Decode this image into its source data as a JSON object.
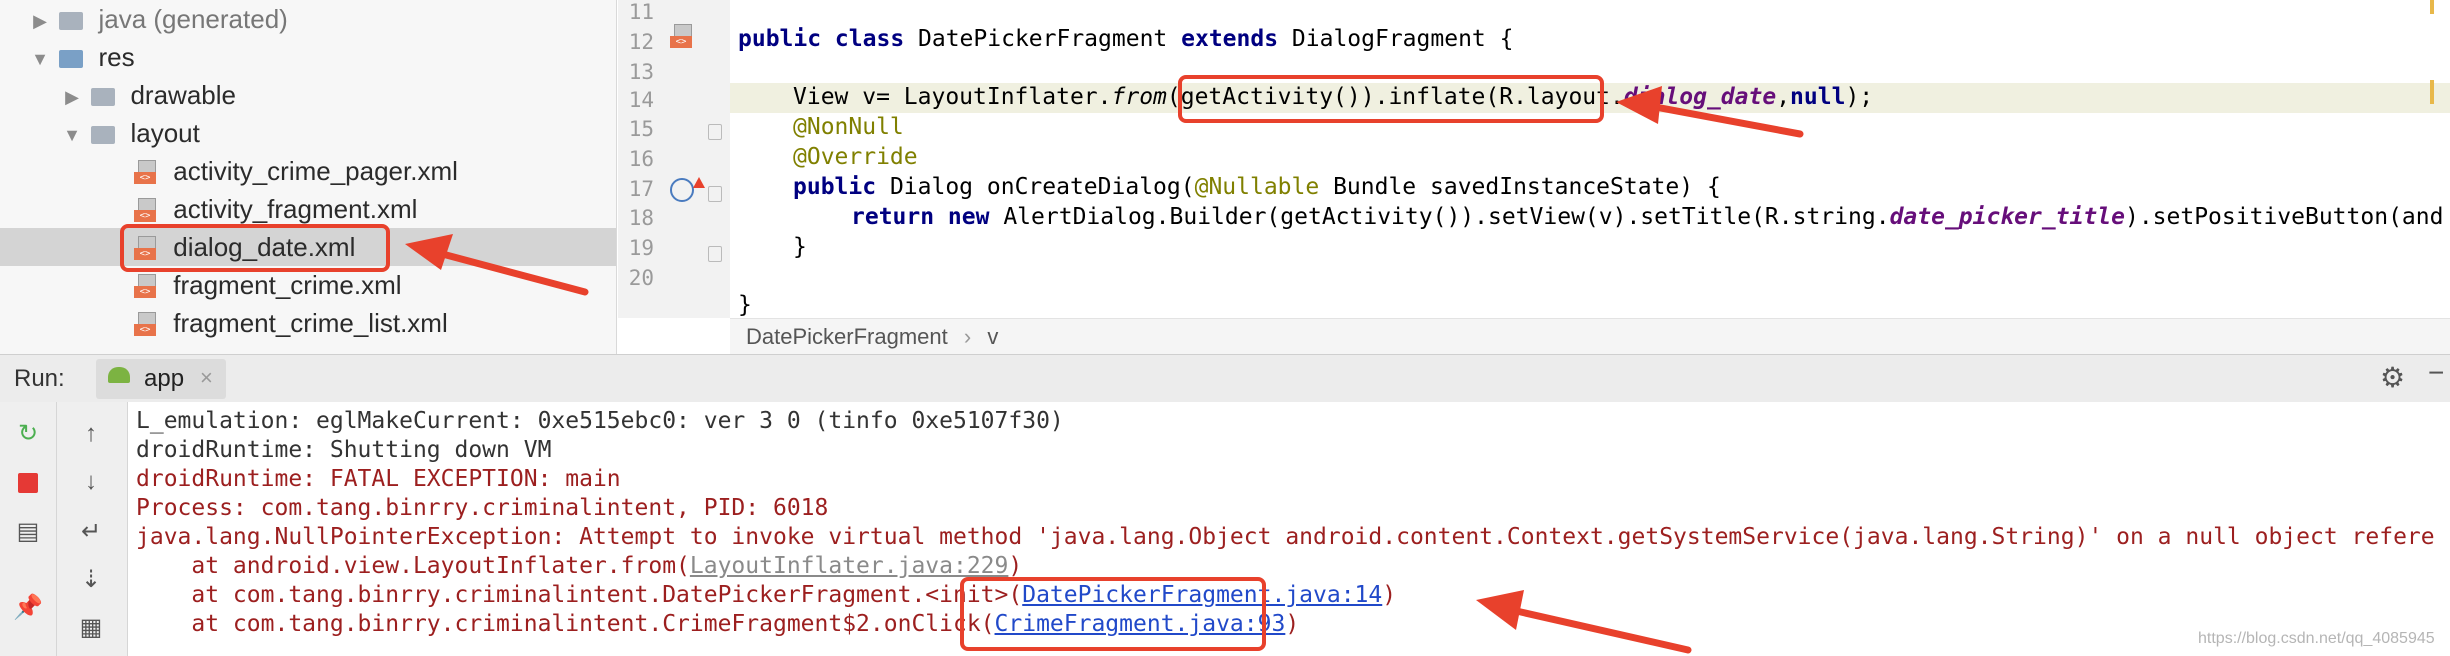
{
  "tree": [
    {
      "arrow": "▶",
      "icon": "folder-icon",
      "label": "java (generated)",
      "muted": true
    },
    {
      "arrow": "▼",
      "icon": "res-folder-icon",
      "label": "res"
    },
    {
      "arrow": "▶",
      "icon": "folder-icon",
      "label": "drawable"
    },
    {
      "arrow": "▼",
      "icon": "folder-icon",
      "label": "layout"
    },
    {
      "icon": "xml-file-icon",
      "label": "activity_crime_pager.xml"
    },
    {
      "icon": "xml-file-icon",
      "label": "activity_fragment.xml"
    },
    {
      "icon": "xml-file-icon",
      "label": "dialog_date.xml",
      "selected": true
    },
    {
      "icon": "xml-file-icon",
      "label": "fragment_crime.xml"
    },
    {
      "icon": "xml-file-icon",
      "label": "fragment_crime_list.xml"
    }
  ],
  "editor": {
    "line_numbers": [
      "11",
      "12",
      "13",
      "14",
      "15",
      "16",
      "17",
      "18",
      "19",
      "20"
    ],
    "line12": {
      "kw1": "public class",
      "name": " DatePickerFragment ",
      "kw2": "extends",
      "rest": " DialogFragment {"
    },
    "line14": {
      "pre": "View v= LayoutInflater.",
      "from": "from",
      "mid": "(getActivity()).inflate(R.layout.",
      "field": "dialog_date",
      "sep": ",",
      "null": "null",
      "end": ");"
    },
    "line15": "@NonNull",
    "line16": "@Override",
    "line17": {
      "kw": "public",
      "a": " Dialog onCreateDialog(",
      "ann": "@Nullable",
      "b": " Bundle savedInstanceState) {"
    },
    "line18": {
      "kw1": "return new",
      "a": " AlertDialog.Builder(getActivity()).setView(v).setTitle(R.string.",
      "field": "date_picker_title",
      "b": ").setPositiveButton(and"
    },
    "line19": "}",
    "line21": "}"
  },
  "breadcrumbs": [
    "DatePickerFragment",
    "v"
  ],
  "breadcrumb_sep": "›",
  "run": {
    "label": "Run:",
    "tab": "app",
    "close": "×"
  },
  "console": [
    {
      "text": "L_emulation: eglMakeCurrent: 0xe515ebc0: ver 3 0 (tinfo 0xe5107f30)",
      "style": "dark"
    },
    {
      "text": "droidRuntime: Shutting down VM",
      "style": "dark"
    },
    {
      "text": "droidRuntime: FATAL EXCEPTION: main"
    },
    {
      "text": "Process: com.tang.binrry.criminalintent, PID: 6018"
    },
    {
      "text": "java.lang.NullPointerException: Attempt to invoke virtual method 'java.lang.Object android.content.Context.getSystemService(java.lang.String)' on a null object refere"
    }
  ],
  "stack": [
    {
      "pre": "    at android.view.LayoutInflater.from(",
      "link": "LayoutInflater.java:229",
      "post": ")",
      "gray": true
    },
    {
      "pre": "    at com.tang.binrry.criminalintent.DatePickerFragment.<init>(",
      "link": "DatePickerFragment.java:14",
      "post": ")"
    },
    {
      "pre": "    at com.tang.binrry.criminalintent.CrimeFragment$2.onClick(",
      "link": "CrimeFragment.java:93",
      "post": ")"
    }
  ],
  "watermark": "https://blog.csdn.net/qq_4085945",
  "colors": {
    "accent_red": "#e8412c",
    "link_blue": "#2149c9",
    "error_red": "#9c1f1f"
  }
}
